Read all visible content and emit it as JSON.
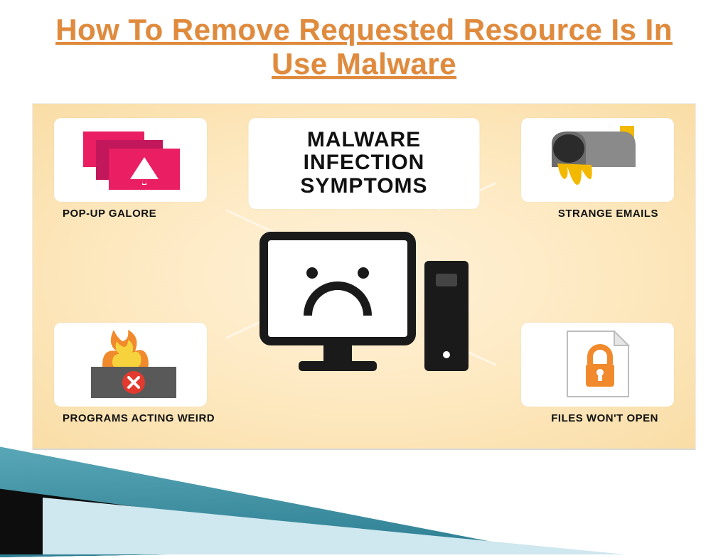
{
  "title": "How To Remove Requested Resource Is In Use Malware",
  "center_heading": "MALWARE INFECTION SYMPTOMS",
  "cards": {
    "top_left": "POP-UP GALORE",
    "top_right": "STRANGE EMAILS",
    "bottom_left": "PROGRAMS ACTING WEIRD",
    "bottom_right": "FILES WON'T OPEN"
  },
  "colors": {
    "title": "#e08a3c",
    "panel_bg": "#fde8bf",
    "pink": "#e91e63",
    "yellow": "#f3b800",
    "dark": "#1a1a1a",
    "accent_orange": "#f08a2c",
    "red": "#e33a2f",
    "gray_box": "#595959"
  }
}
